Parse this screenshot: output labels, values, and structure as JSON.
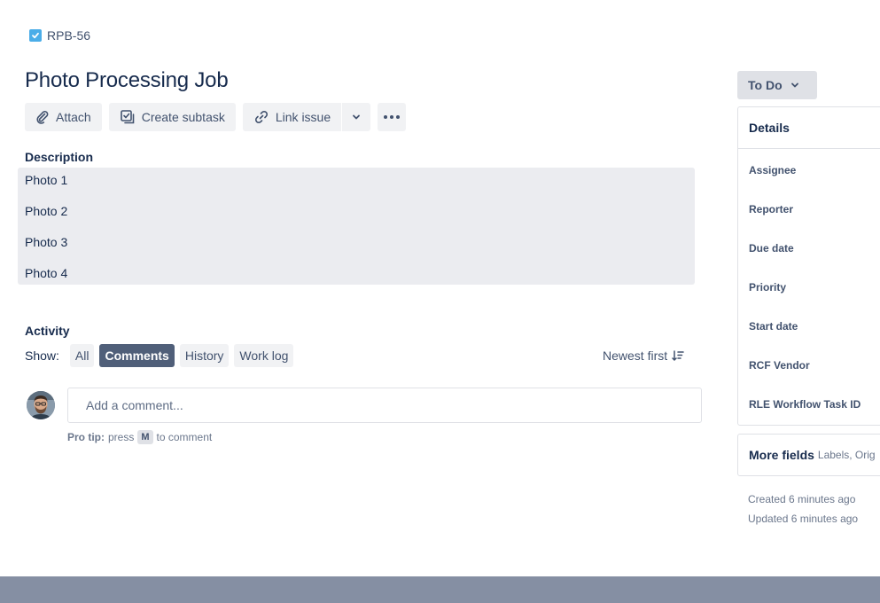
{
  "issue": {
    "key": "RPB-56",
    "title": "Photo Processing Job"
  },
  "toolbar": {
    "attach_label": "Attach",
    "subtask_label": "Create subtask",
    "link_label": "Link issue"
  },
  "description": {
    "label": "Description",
    "lines": [
      "Photo 1",
      "Photo 2",
      "Photo 3",
      "Photo 4"
    ]
  },
  "activity": {
    "label": "Activity",
    "show_label": "Show:",
    "filters": [
      "All",
      "Comments",
      "History",
      "Work log"
    ],
    "active_filter": "Comments",
    "sort_label": "Newest first",
    "comment_placeholder": "Add a comment...",
    "pro_tip_label": "Pro tip:",
    "pro_tip_press": "press",
    "pro_tip_key": "M",
    "pro_tip_suffix": "to comment"
  },
  "status": {
    "label": "To Do"
  },
  "details": {
    "title": "Details",
    "fields": [
      "Assignee",
      "Reporter",
      "Due date",
      "Priority",
      "Start date",
      "RCF Vendor",
      "RLE Workflow Task ID"
    ]
  },
  "more_fields": {
    "title": "More fields",
    "subtitle": "Labels, Orig"
  },
  "meta": {
    "created": "Created 6 minutes ago",
    "updated": "Updated 6 minutes ago"
  },
  "colors": {
    "task_icon": "#4bade8",
    "active_chip": "#505f79",
    "description_bg": "#ebecf0"
  }
}
